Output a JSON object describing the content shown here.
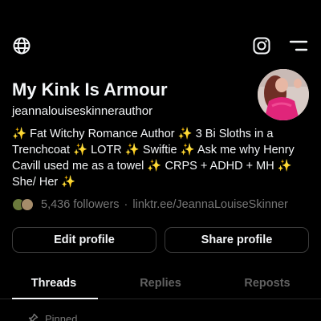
{
  "topbar": {
    "left_icon": "globe-icon",
    "right_icons": [
      "instagram-icon",
      "menu-icon"
    ]
  },
  "profile": {
    "name": "My Kink Is Armour",
    "username": "jeannalouiseskinnerauthor",
    "bio": "✨ Fat Witchy Romance Author ✨ 3 Bi Sloths in a Trenchcoat ✨ LOTR ✨ Swiftie ✨ Ask me why Henry Cavill used me as a towel ✨ CRPS + ADHD + MH ✨ She/ Her ✨",
    "followers": "5,436 followers",
    "separator": "·",
    "link": "linktr.ee/JeannaLouiseSkinner"
  },
  "actions": {
    "edit_label": "Edit profile",
    "share_label": "Share profile"
  },
  "tabs": [
    {
      "label": "Threads",
      "active": true
    },
    {
      "label": "Replies",
      "active": false
    },
    {
      "label": "Reposts",
      "active": false
    }
  ],
  "feed": {
    "pinned_label": "Pinned"
  },
  "colors": {
    "background": "#000000",
    "text_primary": "#f3f5f7",
    "text_secondary": "#777777",
    "border": "#3a3a3a",
    "avatar_accent": "#e0257a"
  }
}
